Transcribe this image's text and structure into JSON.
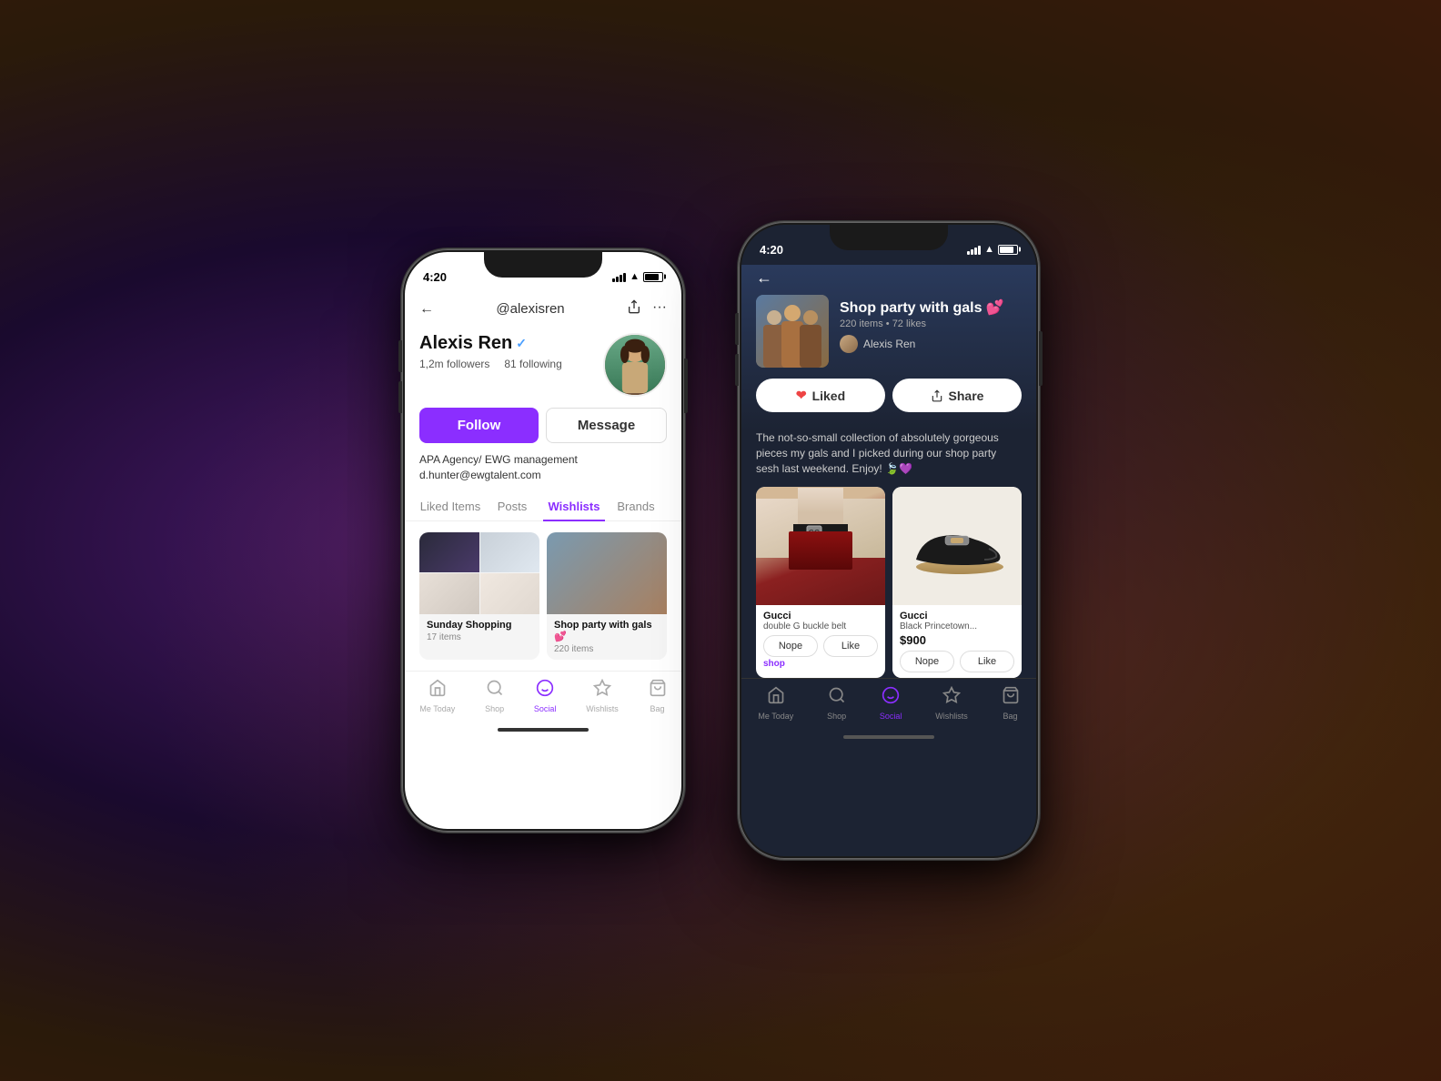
{
  "background": {
    "gradient": "dark purple to brown"
  },
  "phone1": {
    "theme": "light",
    "status_bar": {
      "time": "4:20",
      "signal": "full",
      "wifi": true,
      "battery": "charged"
    },
    "header": {
      "back_icon": "←",
      "title": "@alexisren",
      "share_icon": "share",
      "more_icon": "···"
    },
    "profile": {
      "name": "Alexis Ren",
      "verified": true,
      "followers": "1,2m followers",
      "following": "81 following",
      "bio_line1": "APA Agency/ EWG management",
      "bio_line2": "d.hunter@ewgtalent.com"
    },
    "buttons": {
      "follow": "Follow",
      "message": "Message"
    },
    "tabs": {
      "items": [
        "Liked Items",
        "Posts",
        "Wishlists",
        "Brands"
      ],
      "active": "Wishlists"
    },
    "wishlists": [
      {
        "name": "Sunday Shopping",
        "count": "17 items"
      },
      {
        "name": "Shop party with gals 💕",
        "count": "220 items"
      }
    ],
    "bottom_nav": [
      {
        "label": "Me Today",
        "icon": "🏠",
        "active": false
      },
      {
        "label": "Shop",
        "icon": "🔍",
        "active": false
      },
      {
        "label": "Social",
        "icon": "♪",
        "active": true
      },
      {
        "label": "Wishlists",
        "icon": "☆",
        "active": false
      },
      {
        "label": "Bag",
        "icon": "👜",
        "active": false
      }
    ]
  },
  "phone2": {
    "theme": "dark",
    "status_bar": {
      "time": "4:20",
      "signal": "full",
      "wifi": true,
      "battery": "charged"
    },
    "header": {
      "back_icon": "←"
    },
    "collection": {
      "title": "Shop party with gals 💕",
      "items_count": "220 items",
      "likes": "72 likes",
      "separator": "•",
      "author": "Alexis Ren"
    },
    "action_buttons": {
      "liked": "Liked",
      "share": "Share"
    },
    "description": "The not-so-small collection of absolutely gorgeous pieces my gals and I picked during our shop party sesh last weekend. Enjoy! 🍃💜",
    "items": [
      {
        "brand": "Gucci",
        "name": "double G buckle belt",
        "action": "shop",
        "btn_nope": "Nope",
        "btn_like": "Like"
      },
      {
        "brand": "Gucci",
        "name": "Black Princetown...",
        "price": "$900",
        "btn_nope": "Nope",
        "btn_like": "Like"
      }
    ],
    "bottom_nav": [
      {
        "label": "Me Today",
        "icon": "🏠",
        "active": false
      },
      {
        "label": "Shop",
        "icon": "🔍",
        "active": false
      },
      {
        "label": "Social",
        "icon": "♪",
        "active": true
      },
      {
        "label": "Wishlists",
        "icon": "☆",
        "active": false
      },
      {
        "label": "Bag",
        "icon": "👜",
        "active": false
      }
    ]
  }
}
